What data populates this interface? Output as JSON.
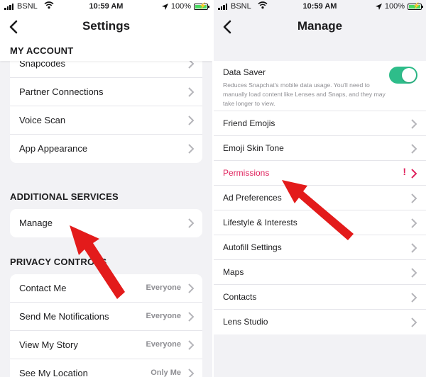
{
  "status_left": {
    "carrier": "BSNL",
    "time": "10:59 AM",
    "battery": "100%"
  },
  "status_right": {
    "carrier": "BSNL",
    "time": "10:59 AM",
    "battery": "100%"
  },
  "settings": {
    "title": "Settings",
    "my_account_header": "MY ACCOUNT",
    "my_account_items": [
      {
        "label": "Snapcodes"
      },
      {
        "label": "Partner Connections"
      },
      {
        "label": "Voice Scan"
      },
      {
        "label": "App Appearance"
      }
    ],
    "additional_header": "ADDITIONAL SERVICES",
    "manage_label": "Manage",
    "privacy_header": "PRIVACY CONTROLS",
    "privacy_items": [
      {
        "label": "Contact Me",
        "value": "Everyone"
      },
      {
        "label": "Send Me Notifications",
        "value": "Everyone"
      },
      {
        "label": "View My Story",
        "value": "Everyone"
      },
      {
        "label": "See My Location",
        "value": "Only Me"
      }
    ]
  },
  "manage": {
    "title": "Manage",
    "data_saver": {
      "label": "Data Saver",
      "description": "Reduces Snapchat's mobile data usage. You'll need to manually load content like Lenses and Snaps, and they may take longer to view.",
      "enabled": true
    },
    "items": [
      {
        "label": "Friend Emojis"
      },
      {
        "label": "Emoji Skin Tone"
      },
      {
        "label": "Permissions",
        "alert": "!"
      },
      {
        "label": "Ad Preferences"
      },
      {
        "label": "Lifestyle & Interests"
      },
      {
        "label": "Autofill Settings"
      },
      {
        "label": "Maps"
      },
      {
        "label": "Contacts"
      },
      {
        "label": "Lens Studio"
      }
    ]
  },
  "colors": {
    "accent_green": "#2ebd8a",
    "alert_red": "#e0245e",
    "arrow_red": "#e31b1b"
  }
}
